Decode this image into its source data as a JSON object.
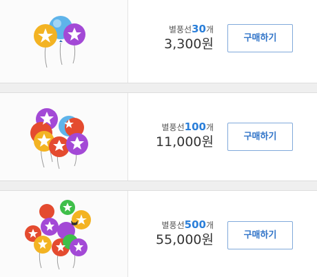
{
  "items": [
    {
      "count": "30",
      "unit_prefix": "별풍선",
      "unit_suffix": "개",
      "price": "3,300원",
      "button": "구매하기",
      "image_icon": "balloons-small-bunch-icon"
    },
    {
      "count": "100",
      "unit_prefix": "별풍선",
      "unit_suffix": "개",
      "price": "11,000원",
      "button": "구매하기",
      "image_icon": "balloons-medium-bunch-icon"
    },
    {
      "count": "500",
      "unit_prefix": "별풍선",
      "unit_suffix": "개",
      "price": "55,000원",
      "button": "구매하기",
      "image_icon": "balloons-large-bunch-icon"
    }
  ],
  "colors": {
    "accent_blue": "#2b7fd9",
    "button_border": "#7fa8da",
    "button_text": "#2f73c8",
    "balloon_purple": "#a349d6",
    "balloon_yellow": "#f3b323",
    "balloon_blue": "#5fb4ea",
    "balloon_red": "#e44b2f",
    "balloon_green": "#3fbf4a"
  }
}
